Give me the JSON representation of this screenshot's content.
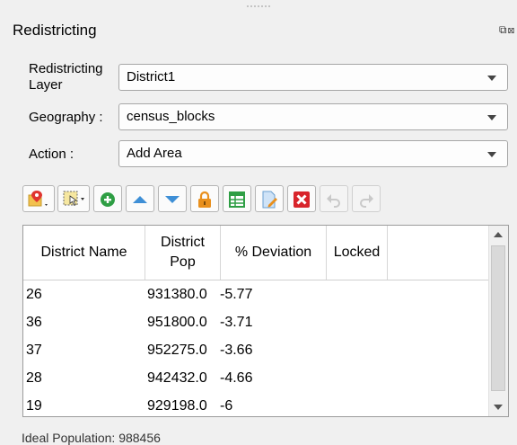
{
  "panel": {
    "title": "Redistricting",
    "float_buttons": "⧉⊠"
  },
  "form": {
    "layer_label": "Redistricting\nLayer",
    "layer_value": "District1",
    "geography_label": "Geography :",
    "geography_value": "census_blocks",
    "action_label": "Action :",
    "action_value": "Add Area"
  },
  "toolbar": {
    "buttons": [
      {
        "name": "map-pin-tool-button",
        "icon": "map-pin-icon"
      },
      {
        "name": "select-tool-button",
        "icon": "select-features-icon"
      },
      {
        "name": "add-district-button",
        "icon": "plus-circle-icon"
      },
      {
        "name": "move-up-button",
        "icon": "arrow-up-icon"
      },
      {
        "name": "move-down-button",
        "icon": "arrow-down-icon"
      },
      {
        "name": "lock-button",
        "icon": "lock-icon"
      },
      {
        "name": "attribute-table-button",
        "icon": "table-icon"
      },
      {
        "name": "edit-button",
        "icon": "edit-document-icon"
      },
      {
        "name": "delete-button",
        "icon": "delete-x-icon"
      },
      {
        "name": "undo-button",
        "icon": "undo-icon"
      },
      {
        "name": "redo-button",
        "icon": "redo-icon"
      }
    ]
  },
  "table": {
    "headers": [
      "District Name",
      "District\nPop",
      "% Deviation",
      "Locked"
    ],
    "rows": [
      {
        "name": "26",
        "pop": "931380.0",
        "dev": "-5.77",
        "locked": ""
      },
      {
        "name": "36",
        "pop": "951800.0",
        "dev": "-3.71",
        "locked": ""
      },
      {
        "name": "37",
        "pop": "952275.0",
        "dev": "-3.66",
        "locked": ""
      },
      {
        "name": "28",
        "pop": "942432.0",
        "dev": "-4.66",
        "locked": ""
      },
      {
        "name": "19",
        "pop": "929198.0",
        "dev": "-6",
        "locked": ""
      }
    ]
  },
  "footer": {
    "ideal_population": "Ideal Population: 988456"
  },
  "colors": {
    "accent_green": "#2e9e44",
    "accent_blue": "#3e8fd6",
    "lock_orange": "#e9901d",
    "delete_red": "#d8242b"
  }
}
